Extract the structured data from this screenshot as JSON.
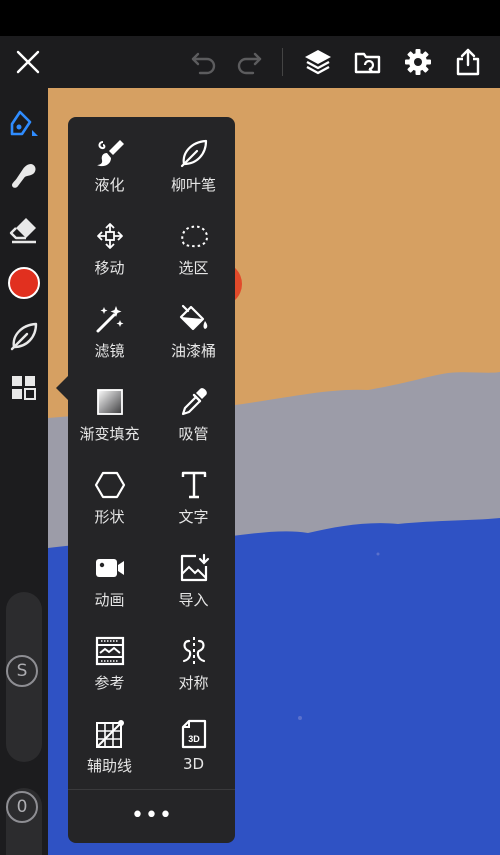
{
  "toolbar": {
    "icons": [
      "close-icon",
      "undo-icon",
      "redo-icon",
      "layers-icon",
      "import-folder-icon",
      "gear-icon",
      "share-icon"
    ]
  },
  "sidebar": {
    "icons": [
      "brush-icon",
      "smudge-icon",
      "eraser-icon",
      "color-swatch",
      "leaf-icon",
      "grid-icon"
    ],
    "active_color": "#e1301f",
    "size_label": "S",
    "opacity_label": "0"
  },
  "canvas": {
    "colors": {
      "sky": "#d6a062",
      "mountain": "#9c9ca8",
      "water": "#2f52c4",
      "sun": "#e24a2a"
    }
  },
  "tool_menu": {
    "tools": [
      {
        "label": "液化",
        "icon": "liquify-icon"
      },
      {
        "label": "柳叶笔",
        "icon": "leaf-pen-icon"
      },
      {
        "label": "移动",
        "icon": "move-icon"
      },
      {
        "label": "选区",
        "icon": "selection-icon"
      },
      {
        "label": "滤镜",
        "icon": "filter-icon"
      },
      {
        "label": "油漆桶",
        "icon": "paint-bucket-icon"
      },
      {
        "label": "渐变填充",
        "icon": "gradient-icon"
      },
      {
        "label": "吸管",
        "icon": "eyedropper-icon"
      },
      {
        "label": "形状",
        "icon": "shape-icon"
      },
      {
        "label": "文字",
        "icon": "text-icon"
      },
      {
        "label": "动画",
        "icon": "animation-icon"
      },
      {
        "label": "导入",
        "icon": "import-image-icon"
      },
      {
        "label": "参考",
        "icon": "reference-icon"
      },
      {
        "label": "对称",
        "icon": "symmetry-icon"
      },
      {
        "label": "辅助线",
        "icon": "guides-icon"
      },
      {
        "label": "3D",
        "icon": "3d-icon"
      }
    ],
    "more_label": "•••"
  }
}
